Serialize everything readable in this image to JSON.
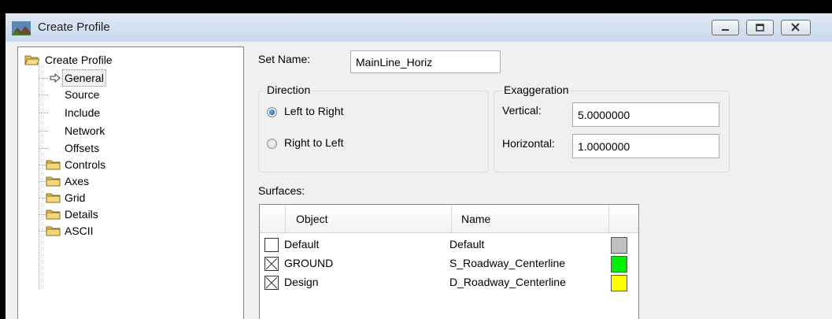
{
  "window": {
    "title": "Create Profile"
  },
  "tree": {
    "root": "Create Profile",
    "items": [
      {
        "label": "General",
        "selected": true
      },
      {
        "label": "Source"
      },
      {
        "label": "Include"
      },
      {
        "label": "Network"
      },
      {
        "label": "Offsets"
      }
    ],
    "folders": [
      "Controls",
      "Axes",
      "Grid",
      "Details",
      "ASCII"
    ]
  },
  "set_name": {
    "label": "Set Name:",
    "value": "MainLine_Horiz"
  },
  "direction": {
    "title": "Direction",
    "options": [
      {
        "label": "Left to Right",
        "checked": true
      },
      {
        "label": "Right to Left",
        "checked": false
      }
    ]
  },
  "exaggeration": {
    "title": "Exaggeration",
    "vertical_label": "Vertical:",
    "vertical_value": "5.0000000",
    "horizontal_label": "Horizontal:",
    "horizontal_value": "1.0000000"
  },
  "surfaces": {
    "label": "Surfaces:",
    "columns": [
      "Object",
      "Name"
    ],
    "rows": [
      {
        "object": "Default",
        "name": "Default",
        "checked": false,
        "color": "#c0c0c0"
      },
      {
        "object": "GROUND",
        "name": "S_Roadway_Centerline",
        "checked": true,
        "color": "#00ee00"
      },
      {
        "object": "Design",
        "name": "D_Roadway_Centerline",
        "checked": true,
        "color": "#ffff00"
      }
    ]
  },
  "colors": {
    "titlebar": "#d0deef",
    "client": "#f0f0f0"
  }
}
